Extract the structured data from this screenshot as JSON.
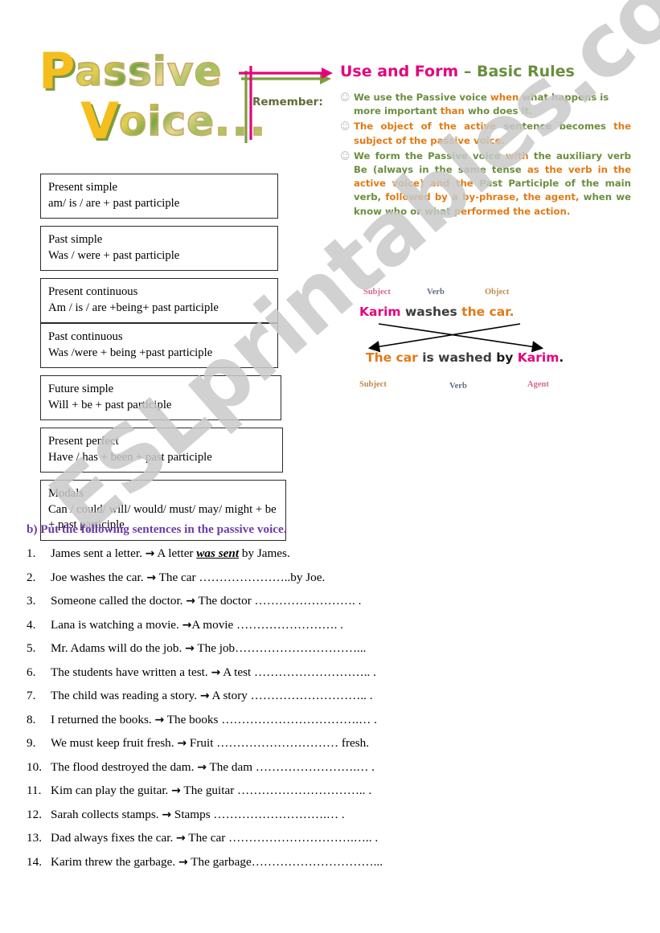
{
  "title": {
    "line1_cap": "P",
    "line1_rest": "assive",
    "line2_cap": "V",
    "line2_rest": "oice",
    "line2_dots": "..."
  },
  "remember": {
    "label": "Remember:"
  },
  "rules": {
    "heading_pink": "Use and Form",
    "heading_dash": "–",
    "heading_olive": "Basic Rules",
    "smiley": "☺",
    "items": [
      {
        "segments": [
          {
            "text": "We use the Passive voice ",
            "color": "olive"
          },
          {
            "text": "when",
            "color": "orange"
          },
          {
            "text": " what happens is more important ",
            "color": "olive"
          },
          {
            "text": "than",
            "color": "orange"
          },
          {
            "text": " who does it.",
            "color": "olive"
          }
        ]
      },
      {
        "segments": [
          {
            "text": "The object of the active ",
            "color": "orange"
          },
          {
            "text": "sentence becomes",
            "color": "olive"
          },
          {
            "text": " the subject of the passive voice.",
            "color": "orange"
          }
        ]
      },
      {
        "segments": [
          {
            "text": "We form the Passive voice ",
            "color": "olive"
          },
          {
            "text": "with",
            "color": "orange"
          },
          {
            "text": " the auxiliary verb Be (always in the same tense ",
            "color": "olive"
          },
          {
            "text": "as the verb in the active voice) and the ",
            "color": "orange"
          },
          {
            "text": "Past Participle of the main verb, ",
            "color": "olive"
          },
          {
            "text": "followed by a by-phrase, the agent, ",
            "color": "orange"
          },
          {
            "text": "when we know who or what ",
            "color": "olive"
          },
          {
            "text": "performed the action.",
            "color": "orange"
          }
        ]
      }
    ]
  },
  "diagram": {
    "label_subject_top": "Subject",
    "label_verb_top": "Verb",
    "label_object_top": "Object",
    "label_subject_bottom": "Subject",
    "label_verb_bottom": "Verb",
    "label_agent_bottom": "Agent",
    "active": {
      "subject": "Karim",
      "verb": " washes ",
      "object": "the car",
      "period": "."
    },
    "passive": {
      "subject": "The car",
      "verb": " is washed ",
      "by": "by ",
      "agent": "Karim",
      "period": "."
    }
  },
  "tense_boxes": [
    {
      "name": "Present simple",
      "form": "am/ is / are + past participle"
    },
    {
      "name": "Past simple",
      "form": "Was / were + past participle"
    },
    {
      "name": "Present continuous",
      "form": "Am / is / are +being+ past participle"
    },
    {
      "name": "Past continuous",
      "form": "Was /were + being +past participle"
    },
    {
      "name": "Future simple",
      "form": "Will + be + past participle"
    },
    {
      "name": "Present perfect",
      "form": "Have / has + been + past participle"
    },
    {
      "name": "Modals",
      "form": "Can / could/ will/ would/ must/ may/ might + be + past participle"
    }
  ],
  "exercise": {
    "heading": "b)  Put the following sentences in the passive voice.",
    "arrow": "→",
    "items": [
      {
        "num": "1.",
        "active": "James sent a letter.",
        "prompt": " A letter ",
        "answer": "was sent",
        "tail": " by James."
      },
      {
        "num": "2.",
        "active": "Joe washes the car.",
        "prompt": " The car ",
        "answer": "",
        "tail": " …………………..by Joe."
      },
      {
        "num": "3.",
        "active": "Someone called the doctor.",
        "prompt": " The doctor ",
        "answer": "",
        "tail": " …………………….  ."
      },
      {
        "num": "4.",
        "active": "Lana is watching a movie.",
        "prompt": "A movie ",
        "answer": "",
        "tail": " …………………….    ."
      },
      {
        "num": "5.",
        "active": "Mr. Adams will do the job.",
        "prompt": " The job",
        "answer": "",
        "tail": "…………………………..."
      },
      {
        "num": "6.",
        "active": "The students have written a test.",
        "prompt": " A test ",
        "answer": "",
        "tail": " ………………………..  ."
      },
      {
        "num": "7.",
        "active": "The child was reading a story.",
        "prompt": " A story ",
        "answer": "",
        "tail": " ………………………..   ."
      },
      {
        "num": "8.",
        "active": "I returned the books.",
        "prompt": " The books ",
        "answer": "",
        "tail": " …………………………….…  ."
      },
      {
        "num": "9.",
        "active": "We must keep fruit fresh.",
        "prompt": " Fruit ",
        "answer": "",
        "tail": " …………………………    fresh."
      },
      {
        "num": "10.",
        "active": "The flood destroyed the dam.",
        "prompt": " The dam ",
        "answer": "",
        "tail": " …………………….…  ."
      },
      {
        "num": "11.",
        "active": "Kim can play the guitar.",
        "prompt": " The guitar ",
        "answer": "",
        "tail": " …………………………..   ."
      },
      {
        "num": "12.",
        "active": "Sarah collects stamps.",
        "prompt": " Stamps ",
        "answer": "",
        "tail": " ……………………….…     ."
      },
      {
        "num": "13.",
        "active": "Dad always fixes the car.",
        "prompt": " The car ",
        "answer": "",
        "tail": " ………………………….…..   ."
      },
      {
        "num": "14.",
        "active": "Karim threw the garbage.",
        "prompt": " The garbage",
        "answer": "",
        "tail": "…………………………..."
      }
    ]
  },
  "watermark": {
    "text": "ESLprintables.com"
  },
  "colors": {
    "pink": "#E5007D",
    "olive": "#6B8E3E",
    "orange": "#E07B15",
    "purple": "#6A3BA8",
    "gold": "#F5BE1E"
  }
}
